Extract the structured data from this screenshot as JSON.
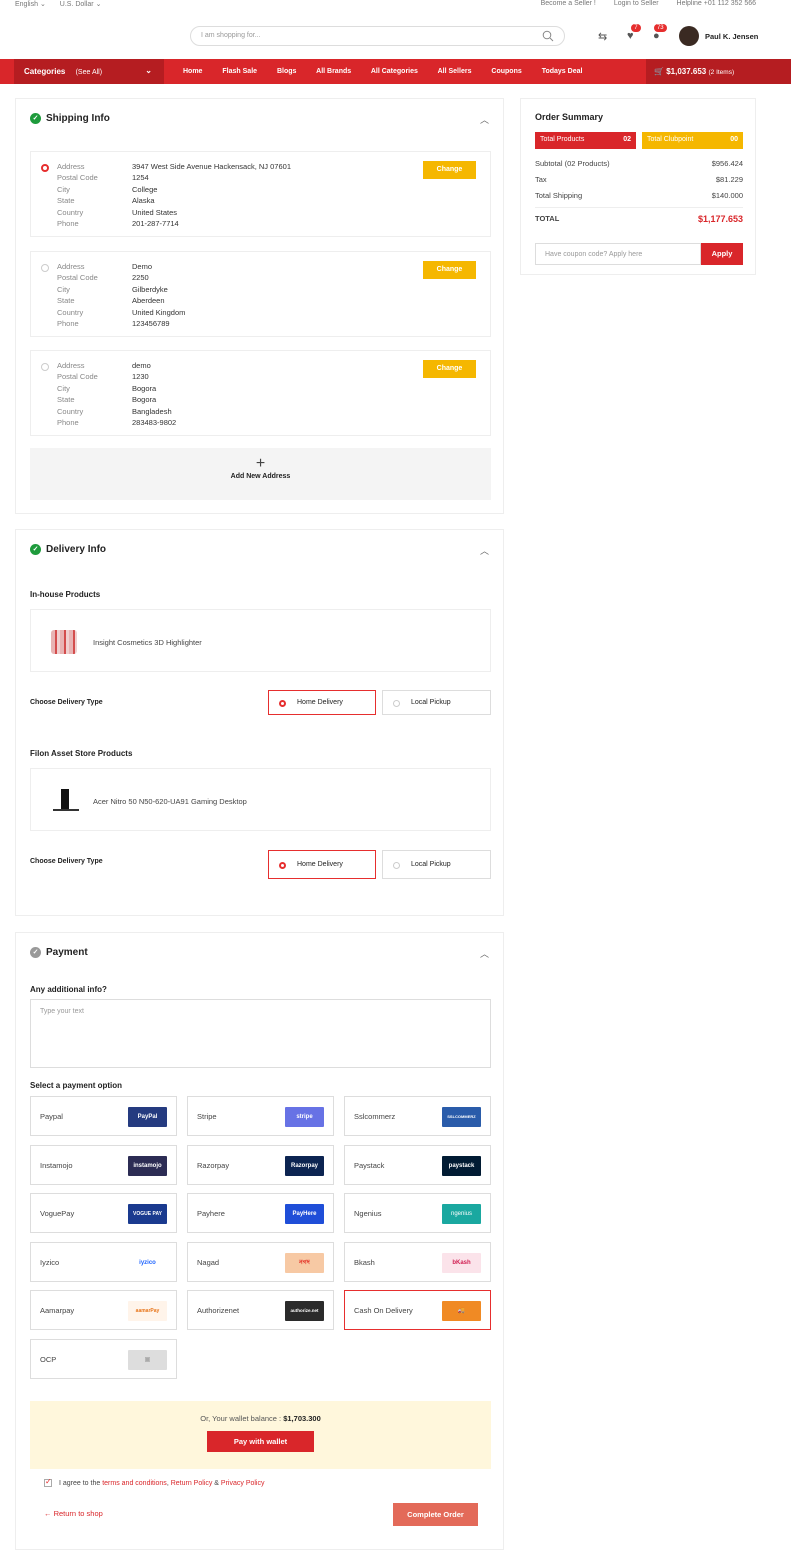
{
  "topbar": {
    "language": "English",
    "currency": "U.S. Dollar",
    "become_seller": "Become a Seller !",
    "login_seller": "Login to Seller",
    "helpline": "Helpline +01 112 352 566"
  },
  "header": {
    "search_placeholder": "I am shopping for...",
    "wishlist_count": "7",
    "notif_count": "73",
    "user_name": "Paul K. Jensen"
  },
  "nav": {
    "categories": "Categories",
    "see_all": "(See All)",
    "links": [
      "Home",
      "Flash Sale",
      "Blogs",
      "All Brands",
      "All Categories",
      "All Sellers",
      "Coupons",
      "Todays Deal"
    ],
    "cart_total": "$1,037.653",
    "cart_items": "(2 Items)"
  },
  "shipping": {
    "title": "Shipping Info",
    "change": "Change",
    "add_new": "Add New Address",
    "labels": [
      "Address",
      "Postal Code",
      "City",
      "State",
      "Country",
      "Phone"
    ],
    "addresses": [
      {
        "address": "3947 West Side Avenue Hackensack, NJ 07601",
        "postal": "1254",
        "city": "College",
        "state": "Alaska",
        "country": "United States",
        "phone": "201-287-7714"
      },
      {
        "address": "Demo",
        "postal": "2250",
        "city": "Gilberdyke",
        "state": "Aberdeen",
        "country": "United Kingdom",
        "phone": "123456789"
      },
      {
        "address": "demo",
        "postal": "1230",
        "city": "Bogora",
        "state": "Bogora",
        "country": "Bangladesh",
        "phone": "283483-9802"
      }
    ]
  },
  "delivery": {
    "title": "Delivery Info",
    "inhouse": "In-house Products",
    "product1": "Insight Cosmetics 3D Highlighter",
    "choose": "Choose Delivery Type",
    "home": "Home Delivery",
    "local": "Local Pickup",
    "store": "Filon Asset Store Products",
    "product2": "Acer Nitro 50 N50-620-UA91 Gaming Desktop"
  },
  "payment": {
    "title": "Payment",
    "additional": "Any additional info?",
    "placeholder": "Type your text",
    "select": "Select a payment option",
    "options": [
      {
        "name": "Paypal",
        "logo": "PayPal",
        "color": "#253b80"
      },
      {
        "name": "Stripe",
        "logo": "stripe",
        "color": "#6772e5"
      },
      {
        "name": "Sslcommerz",
        "logo": "SSLCOMMERZ",
        "color": "#2a5caa"
      },
      {
        "name": "Instamojo",
        "logo": "instamojo",
        "color": "#2c2c54"
      },
      {
        "name": "Razorpay",
        "logo": "Razorpay",
        "color": "#0c2451"
      },
      {
        "name": "Paystack",
        "logo": "paystack",
        "color": "#011b33"
      },
      {
        "name": "VoguePay",
        "logo": "VOGUE PAY",
        "color": "#1a3a8f"
      },
      {
        "name": "Payhere",
        "logo": "PayHere",
        "color": "#1f4ed8"
      },
      {
        "name": "Ngenius",
        "logo": "ngenius",
        "color": "#1aa8a0"
      },
      {
        "name": "Iyzico",
        "logo": "iyzico",
        "color": "#ffffff"
      },
      {
        "name": "Nagad",
        "logo": "নগদ",
        "color": "#f7c9a4"
      },
      {
        "name": "Bkash",
        "logo": "bKash",
        "color": "#fbe3ea"
      },
      {
        "name": "Aamarpay",
        "logo": "aamarPay",
        "color": "#fff4ea"
      },
      {
        "name": "Authorizenet",
        "logo": "authorize.net",
        "color": "#2b2b2b"
      },
      {
        "name": "Cash On Delivery",
        "logo": "COD",
        "color": "#f08a24"
      },
      {
        "name": "OCP",
        "logo": "img",
        "color": "#dddddd"
      }
    ],
    "wallet_text": "Or, Your wallet balance :",
    "wallet_balance": "$1,703.300",
    "pay_wallet": "Pay with wallet",
    "agree_prefix": "I agree to the",
    "terms": "terms and conditions",
    "return_policy": "Return Policy",
    "amp": "&",
    "privacy": "Privacy Policy",
    "return_shop": "Return to shop",
    "complete": "Complete Order"
  },
  "summary": {
    "title": "Order Summary",
    "total_products": "Total Products",
    "total_products_val": "02",
    "total_clubpoint": "Total Clubpoint",
    "total_clubpoint_val": "00",
    "subtotal_label": "Subtotal (02 Products)",
    "subtotal": "$956.424",
    "tax_label": "Tax",
    "tax": "$81.229",
    "shipping_label": "Total Shipping",
    "shipping": "$140.000",
    "total_label": "TOTAL",
    "total": "$1,177.653",
    "coupon_placeholder": "Have coupon code? Apply here",
    "apply": "Apply"
  },
  "colors": {
    "accent": "#d9262a",
    "yellow": "#f5b700"
  }
}
